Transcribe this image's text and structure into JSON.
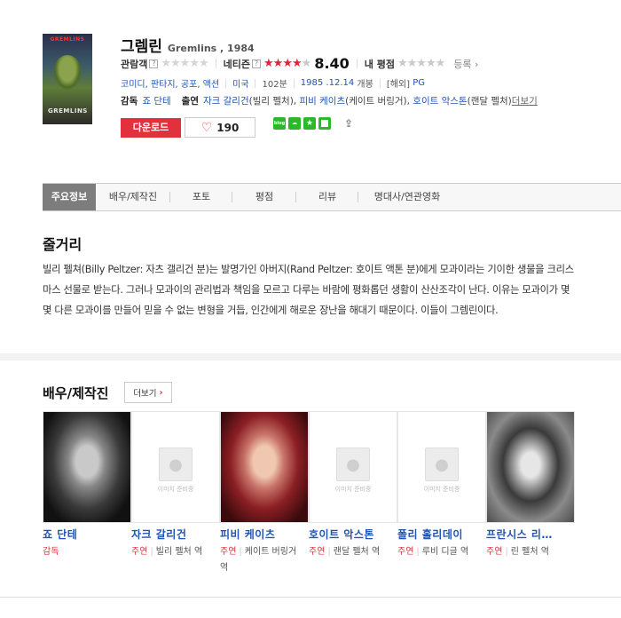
{
  "movie": {
    "poster_title": "GREMLINS",
    "poster_logo": "GREMLINS",
    "title": "그렘린",
    "original": "Gremlins , 1984"
  },
  "ratings": {
    "audience_label": "관람객",
    "audience_stars": "★★★★★",
    "netizen_label": "네티즌",
    "netizen_stars_filled": "★★★★",
    "netizen_stars_empty": "★",
    "netizen_score": "8.40",
    "my_label": "내 평점",
    "my_stars": "★★★★★",
    "register": "등록",
    "help_glyph": "?"
  },
  "info": {
    "genres": "코미디, 판타지, 공포, 액션",
    "country": "미국",
    "runtime": "102분",
    "release": "1985 .12.14",
    "release_suffix": "개봉",
    "rating_prefix": "[해외]",
    "rating": "PG"
  },
  "credits": {
    "director_label": "감독",
    "director": "죠 단테",
    "cast_label": "출연",
    "cast1": "자크 갈리건",
    "cast1_role": "(빌리 펠처),",
    "cast2": "피비 케이츠",
    "cast2_role": "(케이트 버링거),",
    "cast3": "호이트 악스톤",
    "cast3_role": "(랜달 펠처)",
    "more": "더보기"
  },
  "actions": {
    "download": "다운로드",
    "likes": "190",
    "heart": "♡",
    "blog": "blog",
    "talk": "☁",
    "star": "★",
    "share": "⇪"
  },
  "tabs": [
    "주요정보",
    "배우/제작진",
    "포토",
    "평점",
    "리뷰",
    "명대사/연관영화"
  ],
  "synopsis": {
    "title": "줄거리",
    "text": "빌리 펠쳐(Billy Peltzer: 자츠 갤리건 분)는 발명가인 아버지(Rand Peltzer: 호이트 액톤 분)에게 모과이라는 기이한 생물을 크리스마스 선물로 받는다. 그러나 모과이의 관리법과 책임을 모르고 다루는 바람에 평화롭던 생활이 산산조각이 난다. 이유는 모과이가 몇몇 다른 모과이를 만들어 믿을 수 없는 변형을 거듭, 인간에게 해로운 장난을 해대기 때문이다. 이들이 그렘린이다."
  },
  "cast_section": {
    "title": "배우/제작진",
    "more": "더보기",
    "more_arrow": "›",
    "no_image": "이미지 준비중",
    "people": [
      {
        "name": "죠 단테",
        "role": "감독",
        "char": ""
      },
      {
        "name": "자크 갈리건",
        "role": "주연",
        "char": "빌리 펠처 역"
      },
      {
        "name": "피비 케이츠",
        "role": "주연",
        "char": "케이트 버링거 역"
      },
      {
        "name": "호이트 악스톤",
        "role": "주연",
        "char": "랜달 펠처 역"
      },
      {
        "name": "폴리 홀리데이",
        "role": "주연",
        "char": "루비 디글 역"
      },
      {
        "name": "프란시스 리…",
        "role": "주연",
        "char": "린 펠처 역"
      }
    ]
  }
}
